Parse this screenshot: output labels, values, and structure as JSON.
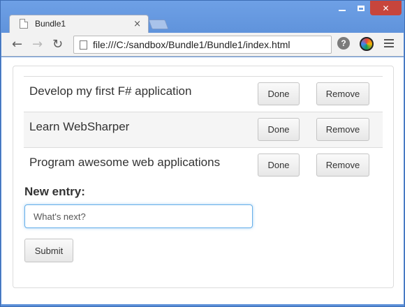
{
  "browser": {
    "tab_title": "Bundle1",
    "url": "file:///C:/sandbox/Bundle1/Bundle1/index.html"
  },
  "todos": [
    {
      "text": "Develop my first F# application",
      "done_label": "Done",
      "remove_label": "Remove"
    },
    {
      "text": "Learn WebSharper",
      "done_label": "Done",
      "remove_label": "Remove"
    },
    {
      "text": "Program awesome web applications",
      "done_label": "Done",
      "remove_label": "Remove"
    }
  ],
  "form": {
    "label": "New entry:",
    "input_value": "What's next?",
    "submit_label": "Submit"
  },
  "icons": {
    "back": "back-arrow-icon",
    "forward": "forward-arrow-icon",
    "reload": "reload-icon",
    "help": "help-icon",
    "extension": "extension-icon",
    "menu": "hamburger-menu-icon"
  }
}
